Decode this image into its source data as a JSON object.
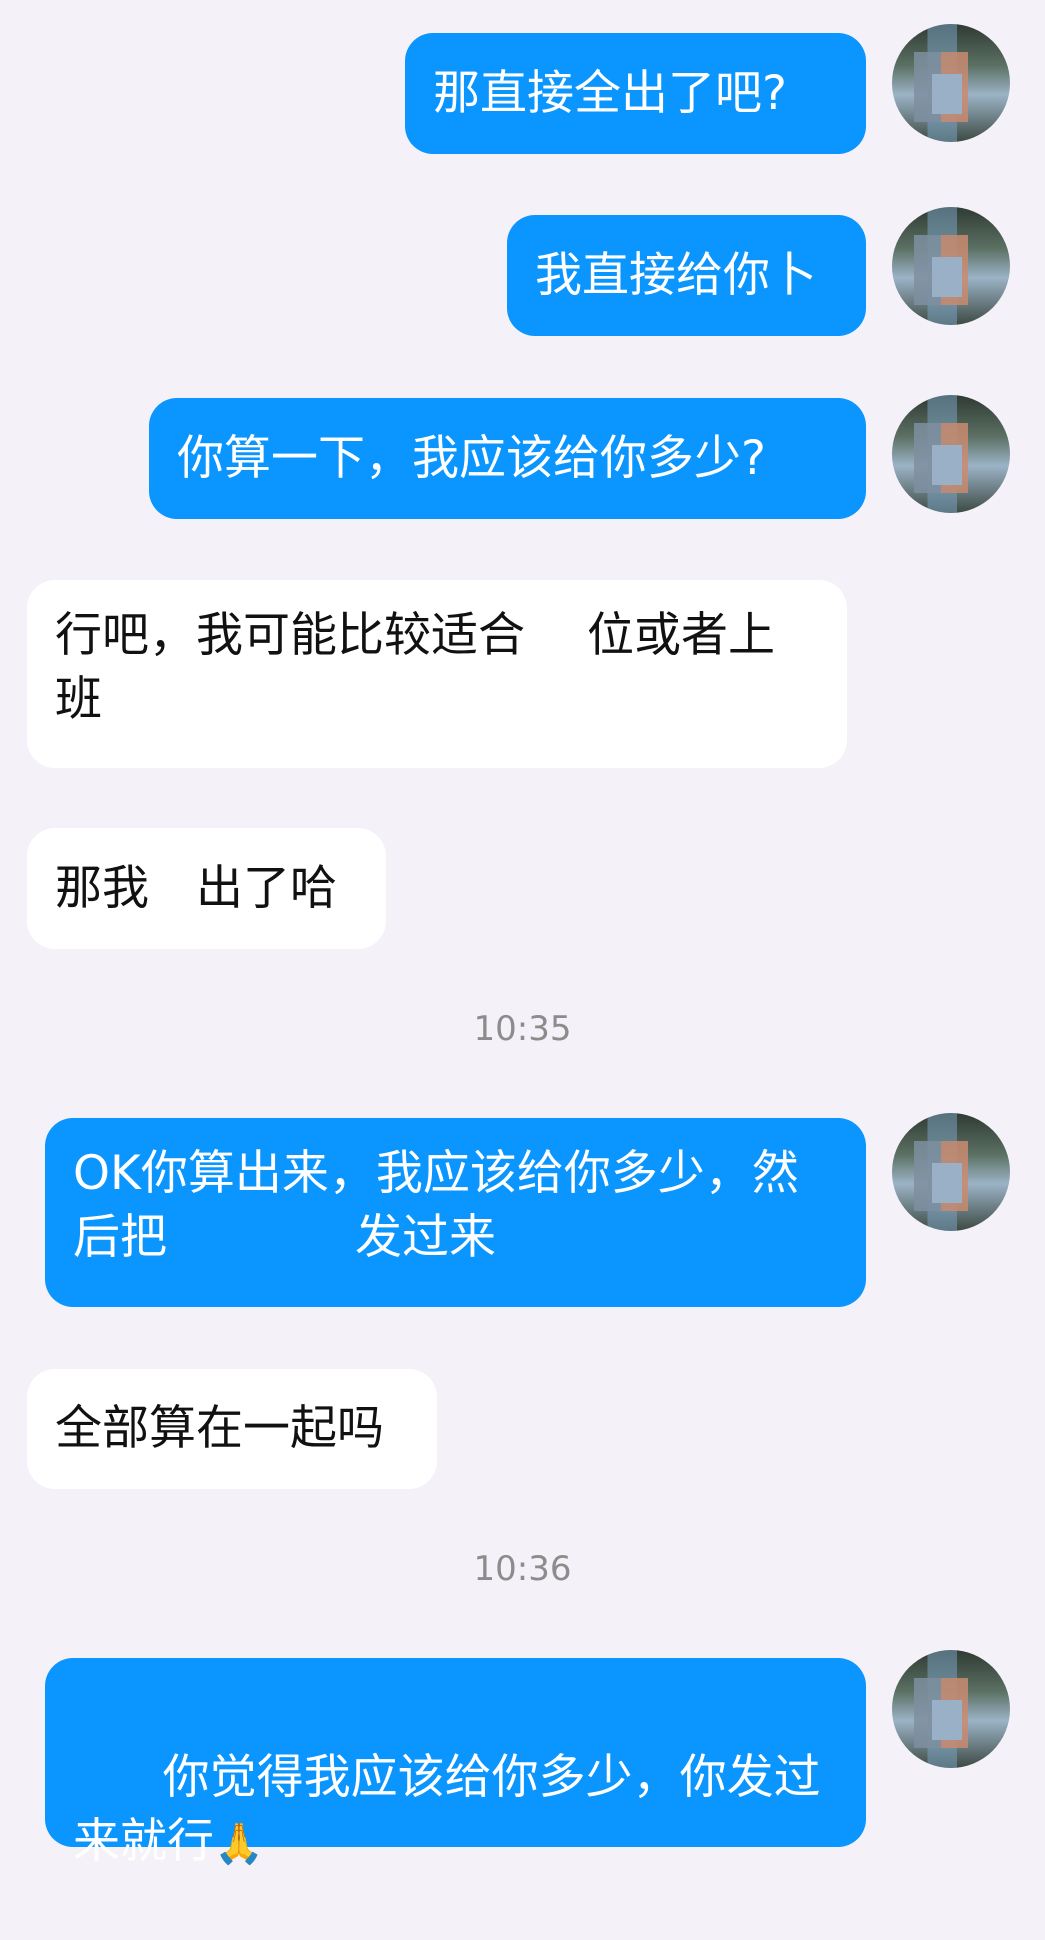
{
  "messages": [
    {
      "side": "out",
      "text": "那直接全出了吧?"
    },
    {
      "side": "out",
      "text": "我直接给你​卜"
    },
    {
      "side": "out",
      "text": "你算一下，我应该给你多少?"
    },
    {
      "side": "in",
      "text": "行吧，我可能比较适合   位或者上班"
    },
    {
      "side": "in",
      "text": "那我  出了哈"
    },
    {
      "side": "out",
      "text": "OK你算出来，我应该给你多少，然后把    发过来"
    },
    {
      "side": "in",
      "text": "全部算在一起吗"
    },
    {
      "side": "out",
      "text": "你觉得我应该给你多少，你发过来就行",
      "emoji": "🙏"
    }
  ],
  "timestamps": [
    "10:35",
    "10:36"
  ]
}
